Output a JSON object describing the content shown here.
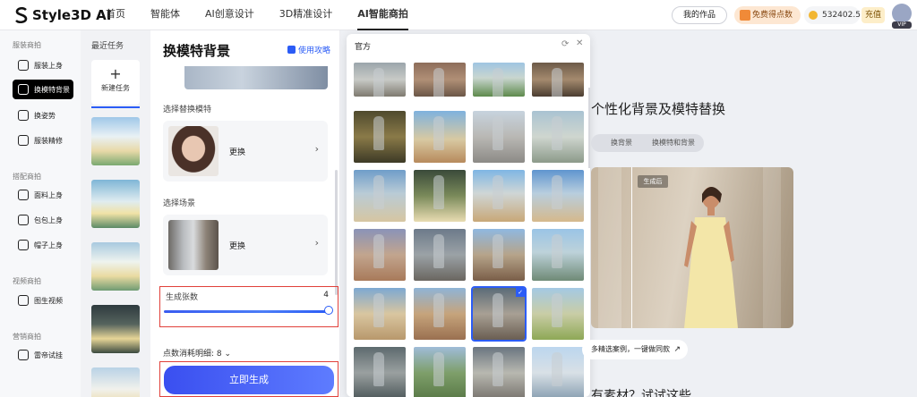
{
  "brand": {
    "name": "Style3D AI"
  },
  "topnav": {
    "tabs": [
      {
        "label": "首页"
      },
      {
        "label": "智能体"
      },
      {
        "label": "AI创意设计"
      },
      {
        "label": "3D精准设计"
      },
      {
        "label": "AI智能商拍",
        "active": true
      }
    ]
  },
  "header": {
    "works": "我的作品",
    "free_points": "免费得点数",
    "points": "532402.5",
    "recharge": "充值",
    "vip": "VIP"
  },
  "sidebar": {
    "sections": [
      {
        "title": "服装商拍",
        "items": [
          {
            "label": "服装上身",
            "icon": "shirt-icon"
          },
          {
            "label": "换模特背景",
            "icon": "background-swap-icon",
            "active": true
          },
          {
            "label": "换姿势",
            "icon": "pose-icon"
          },
          {
            "label": "服装精修",
            "icon": "retouch-icon"
          }
        ]
      },
      {
        "title": "搭配商拍",
        "items": [
          {
            "label": "面料上身",
            "icon": "fabric-icon"
          },
          {
            "label": "包包上身",
            "icon": "bag-icon"
          },
          {
            "label": "帽子上身",
            "icon": "hat-icon"
          }
        ]
      },
      {
        "title": "视频商拍",
        "items": [
          {
            "label": "图生视频",
            "icon": "video-icon"
          }
        ]
      },
      {
        "title": "营销商拍",
        "items": [
          {
            "label": "雷帝试挂",
            "icon": "hanger-icon"
          }
        ]
      }
    ]
  },
  "tasks": {
    "title": "最近任务",
    "new_task": "新建任务"
  },
  "panel": {
    "title": "换模特背景",
    "guide": "使用攻略",
    "model_label": "选择替换模特",
    "model_action": "更换",
    "scene_label": "选择场景",
    "scene_action": "更换",
    "count_label": "生成张数",
    "count_value": "4",
    "count_level": 1.0,
    "cost": "点数消耗明细: 8 ⌄",
    "generate": "立即生成"
  },
  "popup": {
    "title": "官方",
    "refresh": "⟳",
    "close": "✕"
  },
  "showcase": {
    "title": "个性化背景及模特替换",
    "tabs": [
      "换背景",
      "换模特和背景"
    ],
    "after_badge": "生成后",
    "select_bar": "多精选案例，一键做同款",
    "select_arrow": "↗",
    "bottom_text": "有素材？试试这些"
  },
  "colors": {
    "accent": "#2b5cf6",
    "highlight": "#e0403a"
  }
}
